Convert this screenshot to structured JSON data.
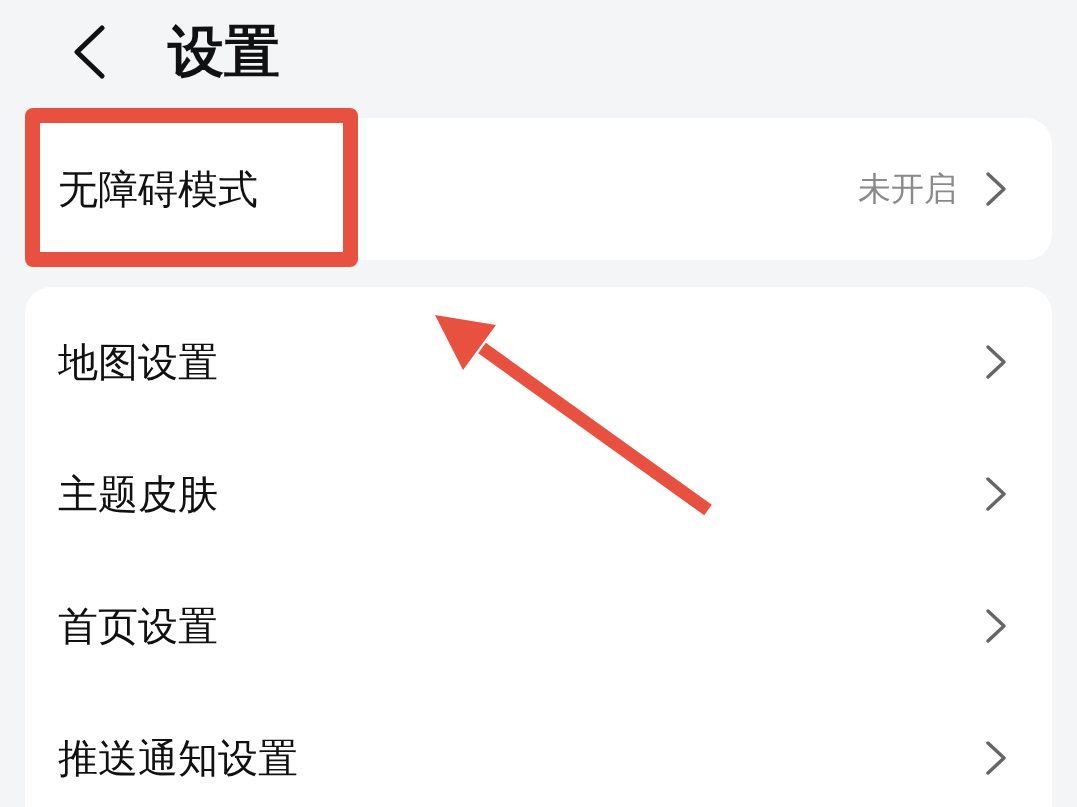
{
  "header": {
    "title": "设置"
  },
  "top_card": {
    "label": "无障碍模式",
    "status": "未开启"
  },
  "settings": [
    {
      "label": "地图设置"
    },
    {
      "label": "主题皮肤"
    },
    {
      "label": "首页设置"
    },
    {
      "label": "推送通知设置"
    }
  ]
}
